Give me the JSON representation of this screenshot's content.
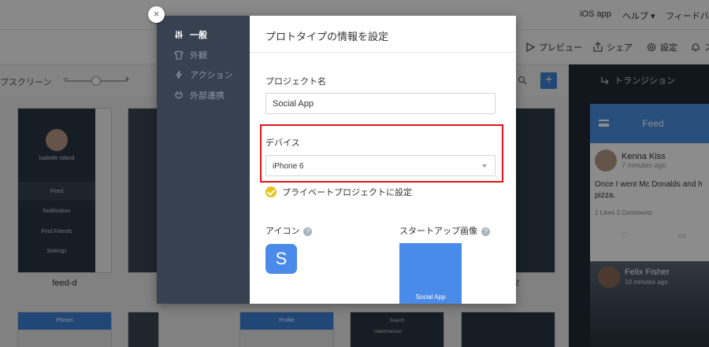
{
  "background": {
    "topbar": {
      "project": "iOS app",
      "help": "ヘルプ ▾",
      "feedback": "フィードバック"
    },
    "toolbar": {
      "preview": "プレビュー",
      "share": "シェア",
      "settings": "設定",
      "last": "ス"
    },
    "subbar": {
      "screens_label": "プスクリーン",
      "zoom_minus": "−",
      "zoom_plus": "+",
      "add": "+"
    },
    "cards": [
      {
        "label": "feed-d",
        "user": "Isabelle Island",
        "menu": [
          "Feed",
          "Notification",
          "Find Friends",
          "Settings"
        ]
      },
      {
        "label": ""
      },
      {
        "label": "2"
      }
    ],
    "bottom_cards": [
      "Photos",
      "",
      "Profile",
      "Search",
      "natemharson"
    ],
    "right_panel": {
      "header": "トランジション",
      "phone": {
        "title": "Feed",
        "post1": {
          "name": "Kenna Kiss",
          "time": "7 minutes ago",
          "text": "Once I went Mc Donalds and h pizza.",
          "meta": "1 Likes   2 Comments"
        },
        "post2": {
          "name": "Felix Fisher",
          "time": "10 minutes ago"
        }
      }
    }
  },
  "modal": {
    "title": "プロトタイプの情報を設定",
    "close": "×",
    "nav": [
      {
        "label": "一般",
        "icon": "sliders-icon",
        "active": true
      },
      {
        "label": "外観",
        "icon": "shirt-icon",
        "active": false
      },
      {
        "label": "アクション",
        "icon": "lightning-icon",
        "active": false
      },
      {
        "label": "外部連携",
        "icon": "plug-icon",
        "active": false
      }
    ],
    "project_name": {
      "label": "プロジェクト名",
      "value": "Social App"
    },
    "device": {
      "label": "デバイス",
      "value": "iPhone 6"
    },
    "private": {
      "label": "プライベートプロジェクトに設定",
      "checked": true
    },
    "icon": {
      "label": "アイコン",
      "letter": "S",
      "help": "?"
    },
    "launch": {
      "label": "スタートアップ画像",
      "text": "Social App",
      "help": "?"
    }
  }
}
